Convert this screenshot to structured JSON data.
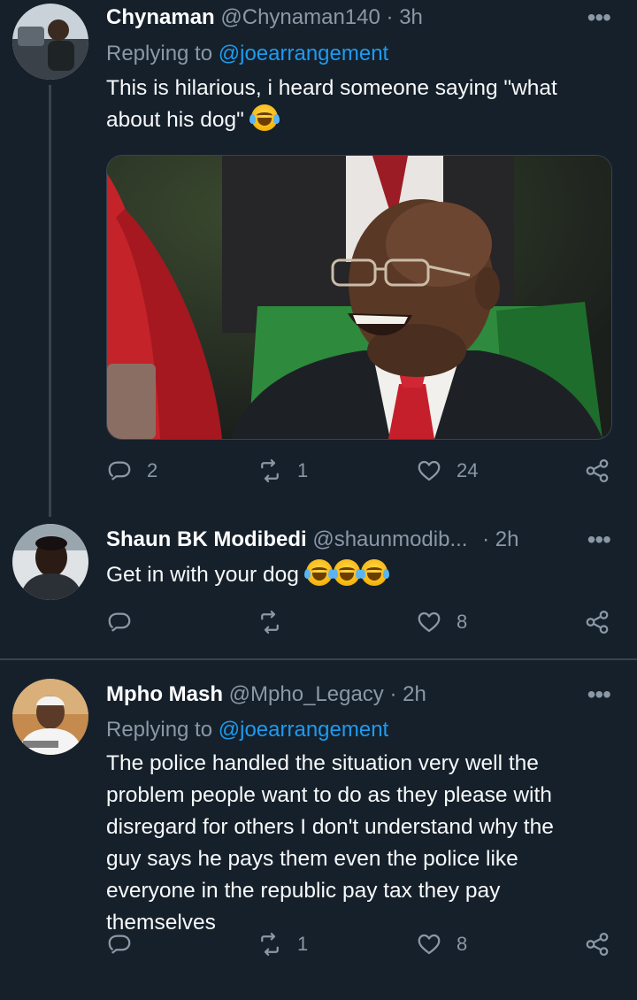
{
  "tweets": [
    {
      "name": "Chynaman",
      "handle": "@Chynaman140",
      "sep": "·",
      "time": "3h",
      "replying_prefix": "Replying to ",
      "replying_to": "@joearrangement",
      "text": "This is hilarious, i heard someone saying \"what about his dog\"",
      "emoji": "face-with-tears-of-joy",
      "replies": "2",
      "retweets": "1",
      "likes": "24"
    },
    {
      "name": "Shaun BK Modibedi",
      "handle": "@shaunmodib...",
      "sep": "·",
      "time": "2h",
      "text": "Get in with your dog",
      "emoji": "face-with-tears-of-joy x3",
      "replies": "",
      "retweets": "",
      "likes": "8"
    },
    {
      "name": "Mpho Mash",
      "handle": "@Mpho_Legacy",
      "sep": "·",
      "time": "2h",
      "replying_prefix": "Replying to ",
      "replying_to": "@joearrangement",
      "text_lines": [
        "The police handled the situation very well the",
        "problem people want to do as they please with",
        "disregard for others I don't understand why the",
        "guy says he pays them even the police like",
        "everyone in the republic pay tax they pay",
        "themselves"
      ],
      "replies": "",
      "retweets": "1",
      "likes": "8"
    }
  ],
  "more_icon": "more-horizontal-icon",
  "colors": {
    "background": "#15202b",
    "secondary": "#8b98a5",
    "accent": "#1d9bf0",
    "divider": "#38444d"
  }
}
